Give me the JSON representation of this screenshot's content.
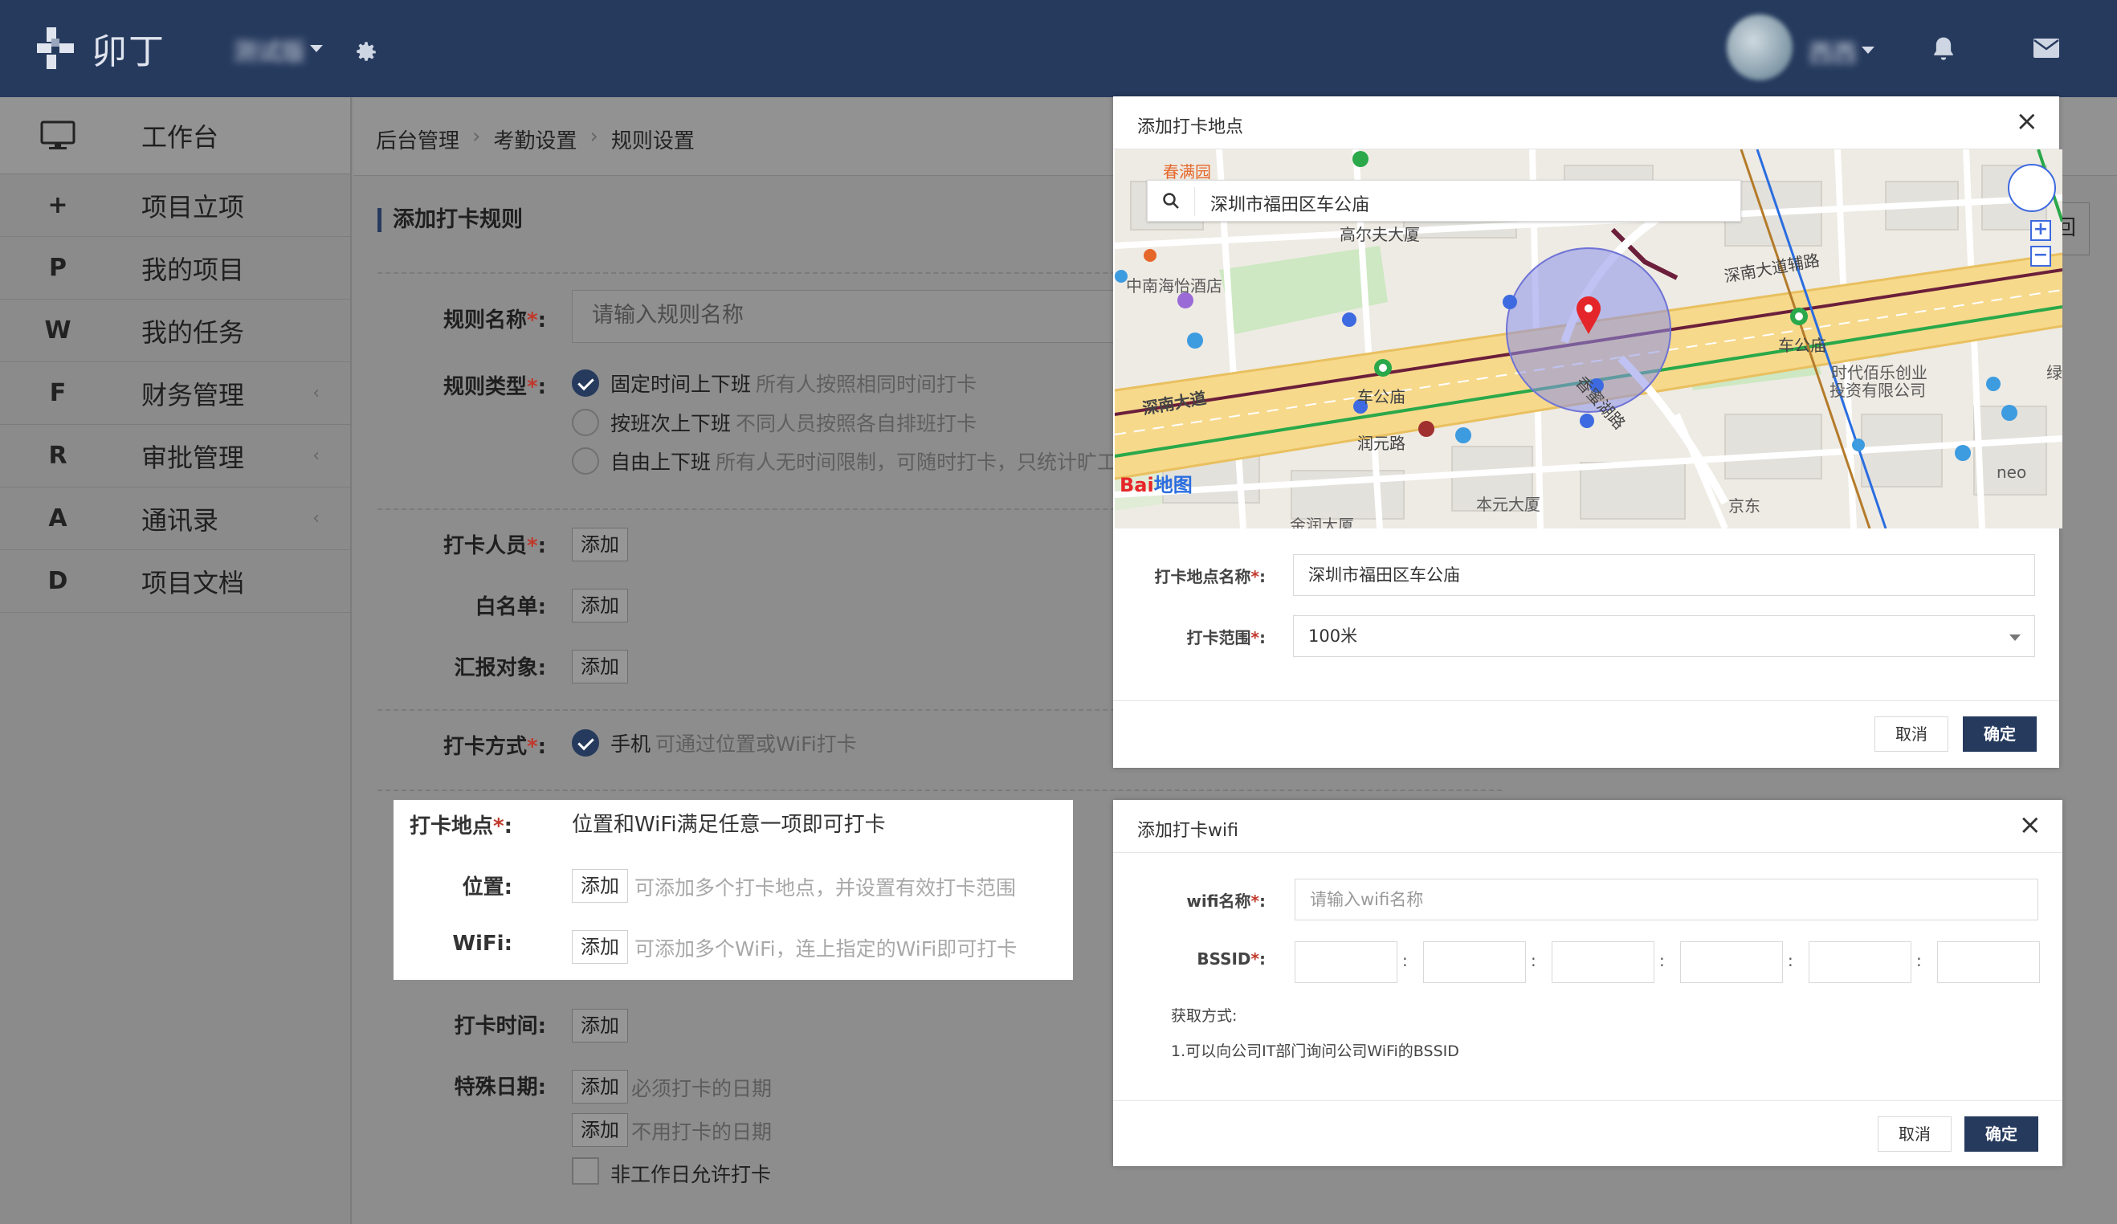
{
  "header": {
    "logo_text": "卯丁",
    "tenant": "测试版",
    "username": "西西"
  },
  "sidebar": {
    "workbench": "工作台",
    "items": [
      {
        "icon": "+",
        "label": "项目立项",
        "chevron": ""
      },
      {
        "icon": "P",
        "label": "我的项目",
        "chevron": ""
      },
      {
        "icon": "W",
        "label": "我的任务",
        "chevron": ""
      },
      {
        "icon": "F",
        "label": "财务管理",
        "chevron": "‹"
      },
      {
        "icon": "R",
        "label": "审批管理",
        "chevron": "‹"
      },
      {
        "icon": "A",
        "label": "通讯录",
        "chevron": "‹"
      },
      {
        "icon": "D",
        "label": "项目文档",
        "chevron": ""
      }
    ]
  },
  "breadcrumb": [
    "后台管理",
    "考勤设置",
    "规则设置"
  ],
  "form": {
    "section_title": "添加打卡规则",
    "back_button": "回",
    "rule_name": {
      "label": "规则名称",
      "placeholder": "请输入规则名称"
    },
    "rule_type": {
      "label": "规则类型",
      "options": [
        {
          "label": "固定时间上下班",
          "hint": "所有人按照相同时间打卡",
          "checked": true
        },
        {
          "label": "按班次上下班",
          "hint": "不同人员按照各自排班打卡",
          "checked": false
        },
        {
          "label": "自由上下班",
          "hint": "所有人无时间限制，可随时打卡，只统计旷工",
          "checked": false
        }
      ]
    },
    "staff": {
      "label": "打卡人员",
      "button": "添加"
    },
    "whitelist": {
      "label": "白名单",
      "button": "添加"
    },
    "report_to": {
      "label": "汇报对象",
      "button": "添加"
    },
    "method": {
      "label": "打卡方式",
      "option": "手机",
      "hint": "可通过位置或WiFi打卡"
    },
    "location": {
      "label": "打卡地点",
      "description": "位置和WiFi满足任意一项即可打卡",
      "position_label": "位置:",
      "position_button": "添加",
      "position_hint": "可添加多个打卡地点，并设置有效打卡范围",
      "wifi_label": "WiFi:",
      "wifi_button": "添加",
      "wifi_hint": "可添加多个WiFi，连上指定的WiFi即可打卡"
    },
    "time": {
      "label": "打卡时间:",
      "button": "添加"
    },
    "special": {
      "label": "特殊日期:",
      "must_button": "添加",
      "must_hint": "必须打卡的日期",
      "no_button": "添加",
      "no_hint": "不用打卡的日期",
      "nonwork_checkbox": "非工作日允许打卡"
    }
  },
  "location_modal": {
    "title": "添加打卡地点",
    "search_value": "深圳市福田区车公庙",
    "map_labels": {
      "hotel": "中南海怡酒店",
      "building1": "高尔夫大厦",
      "road1": "深南大道辅路",
      "station_left": "车公庙",
      "station_right": "车公庙",
      "road2": "深南大道",
      "road3": "香蜜湖路",
      "road4": "润元路",
      "building2": "本元大厦",
      "building3": "金润大厦",
      "poi1": "时代佰乐创业",
      "poi2": "投资有限公司",
      "poi3": "京东",
      "poi4": "neo",
      "poi5": "春满园",
      "poi6": "绿"
    },
    "name_label": "打卡地点名称",
    "name_value": "深圳市福田区车公庙",
    "range_label": "打卡范围",
    "range_value": "100米",
    "cancel": "取消",
    "ok": "确定"
  },
  "wifi_modal": {
    "title": "添加打卡wifi",
    "name_label": "wifi名称",
    "name_placeholder": "请输入wifi名称",
    "bssid_label": "BSSID",
    "bssid_sep": ":",
    "howto_title": "获取方式:",
    "howto_1": "1.可以向公司IT部门询问公司WiFi的BSSID",
    "cancel": "取消",
    "ok": "确定"
  },
  "colors": {
    "brand": "#263a5e",
    "required": "#c0392b",
    "overlay": "#8d8d8d",
    "map_circle": "#8b8fe8"
  }
}
